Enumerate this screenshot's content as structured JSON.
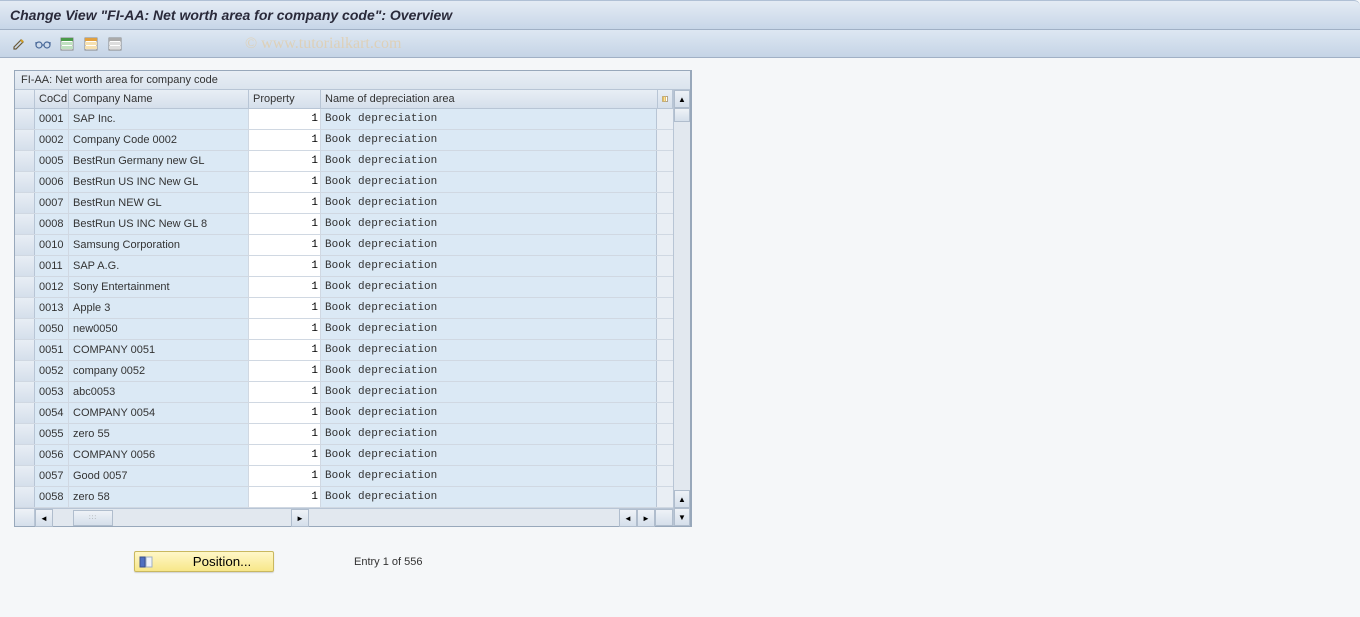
{
  "title": "Change View \"FI-AA: Net worth area for company code\": Overview",
  "watermark": "© www.tutorialkart.com",
  "toolbar": {
    "icons": [
      "pencil",
      "glasses",
      "table-green",
      "table-orange",
      "table-gray"
    ]
  },
  "table": {
    "caption": "FI-AA: Net worth area for company code",
    "columns": {
      "cocd": "CoCd",
      "company_name": "Company Name",
      "property": "Property",
      "area_name": "Name of depreciation area"
    },
    "rows": [
      {
        "cocd": "0001",
        "name": "SAP Inc.",
        "property": "1",
        "area": "Book depreciation"
      },
      {
        "cocd": "0002",
        "name": "Company Code 0002",
        "property": "1",
        "area": "Book depreciation"
      },
      {
        "cocd": "0005",
        "name": "BestRun Germany new GL",
        "property": "1",
        "area": "Book depreciation"
      },
      {
        "cocd": "0006",
        "name": "BestRun US INC New GL",
        "property": "1",
        "area": "Book depreciation"
      },
      {
        "cocd": "0007",
        "name": "BestRun NEW GL",
        "property": "1",
        "area": "Book depreciation"
      },
      {
        "cocd": "0008",
        "name": "BestRun US INC New GL 8",
        "property": "1",
        "area": "Book depreciation"
      },
      {
        "cocd": "0010",
        "name": "Samsung Corporation",
        "property": "1",
        "area": "Book depreciation"
      },
      {
        "cocd": "0011",
        "name": "SAP A.G.",
        "property": "1",
        "area": "Book depreciation"
      },
      {
        "cocd": "0012",
        "name": "Sony Entertainment",
        "property": "1",
        "area": "Book depreciation"
      },
      {
        "cocd": "0013",
        "name": "Apple 3",
        "property": "1",
        "area": "Book depreciation"
      },
      {
        "cocd": "0050",
        "name": "new0050",
        "property": "1",
        "area": "Book depreciation"
      },
      {
        "cocd": "0051",
        "name": "COMPANY 0051",
        "property": "1",
        "area": "Book depreciation"
      },
      {
        "cocd": "0052",
        "name": "company 0052",
        "property": "1",
        "area": "Book depreciation"
      },
      {
        "cocd": "0053",
        "name": "abc0053",
        "property": "1",
        "area": "Book depreciation"
      },
      {
        "cocd": "0054",
        "name": "COMPANY 0054",
        "property": "1",
        "area": "Book depreciation"
      },
      {
        "cocd": "0055",
        "name": "zero 55",
        "property": "1",
        "area": "Book depreciation"
      },
      {
        "cocd": "0056",
        "name": "COMPANY 0056",
        "property": "1",
        "area": "Book depreciation"
      },
      {
        "cocd": "0057",
        "name": "Good 0057",
        "property": "1",
        "area": "Book depreciation"
      },
      {
        "cocd": "0058",
        "name": "zero 58",
        "property": "1",
        "area": "Book depreciation"
      }
    ]
  },
  "footer": {
    "position_label": "Position...",
    "entry_text": "Entry 1 of 556"
  }
}
